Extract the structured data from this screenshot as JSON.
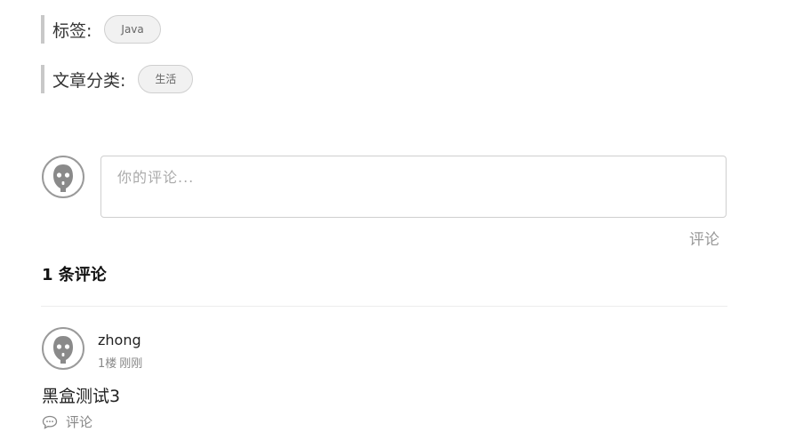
{
  "post_meta": {
    "tags_label": "标签:",
    "tags": [
      "Java"
    ],
    "category_label": "文章分类:",
    "categories": [
      "生活"
    ]
  },
  "comment_form": {
    "placeholder": "你的评论...",
    "submit_label": "评论"
  },
  "comments_section": {
    "count_title": "1 条评论",
    "comments": [
      {
        "author": "zhong",
        "floor": "1楼",
        "time": "刚刚",
        "text": "黑盒测试3",
        "reply_label": "评论",
        "reply_icon": "speech-bubble-icon"
      }
    ]
  },
  "icons": {
    "avatar": "ghost-avatar-icon"
  }
}
